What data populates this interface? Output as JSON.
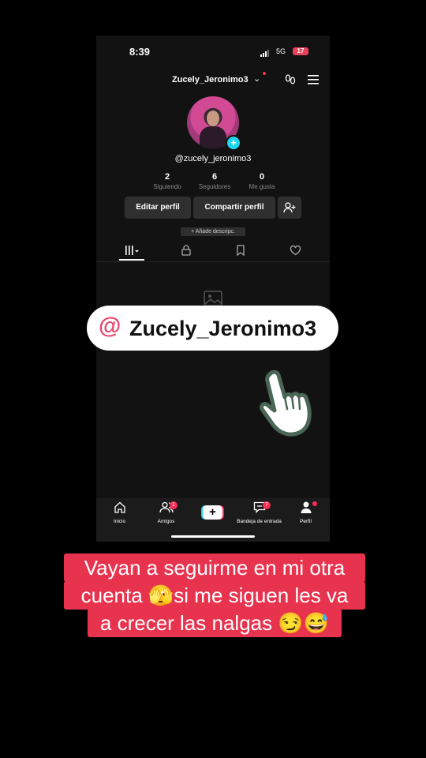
{
  "status": {
    "time": "8:39",
    "network": "5G",
    "battery": "17"
  },
  "profile": {
    "username": "Zucely_Jeronimo3",
    "handle": "@zucely_jeronimo3",
    "stats": [
      {
        "value": "2",
        "label": "Siguiendo"
      },
      {
        "value": "6",
        "label": "Seguidores"
      },
      {
        "value": "0",
        "label": "Me gusta"
      }
    ],
    "edit_label": "Editar perfil",
    "share_label": "Compartir perfil",
    "add_desc": "+ Añade descripc."
  },
  "tabs": [
    "videos-grid-icon",
    "lock-icon",
    "bookmark-icon",
    "liked-heart-icon"
  ],
  "nav": {
    "items": [
      {
        "label": "Inicio",
        "icon": "home-icon"
      },
      {
        "label": "Amigos",
        "icon": "friends-icon",
        "badge": "1"
      },
      {
        "label": "",
        "icon": "create-icon"
      },
      {
        "label": "Bandeja de entrada",
        "icon": "inbox-icon",
        "badge": "7"
      },
      {
        "label": "Perfil",
        "icon": "profile-icon"
      }
    ]
  },
  "overlay": {
    "at": "@",
    "name": "Zucely_Jeronimo3",
    "caption": [
      "Vayan a seguirme en mi otra",
      "cuenta 🫣si me siguen les va",
      "a crecer las nalgas 😏😅"
    ]
  },
  "colors": {
    "accent": "#fe2c55",
    "teal": "#20d5ec",
    "caption_bg": "#e8334f"
  }
}
